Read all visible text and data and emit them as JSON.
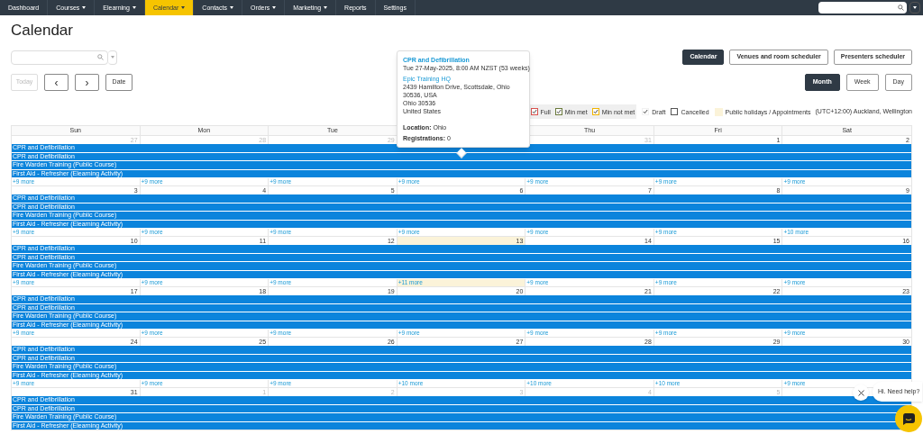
{
  "nav": {
    "items": [
      {
        "label": "Dashboard",
        "dropdown": false,
        "selected": false
      },
      {
        "label": "Courses",
        "dropdown": true,
        "selected": false
      },
      {
        "label": "Elearning",
        "dropdown": true,
        "selected": false
      },
      {
        "label": "Calendar",
        "dropdown": true,
        "selected": true
      },
      {
        "label": "Contacts",
        "dropdown": true,
        "selected": false
      },
      {
        "label": "Orders",
        "dropdown": true,
        "selected": false
      },
      {
        "label": "Marketing",
        "dropdown": true,
        "selected": false
      },
      {
        "label": "Reports",
        "dropdown": false,
        "selected": false
      },
      {
        "label": "Settings",
        "dropdown": false,
        "selected": false
      }
    ]
  },
  "page_title": "Calendar",
  "view_switch": [
    {
      "label": "Calendar",
      "selected": true
    },
    {
      "label": "Venues and room scheduler",
      "selected": false
    },
    {
      "label": "Presenters scheduler",
      "selected": false
    }
  ],
  "nav_buttons": [
    {
      "label": "Today",
      "disabled": true
    },
    {
      "label": "‹",
      "disabled": false
    },
    {
      "label": "›",
      "disabled": false
    },
    {
      "label": "Date",
      "disabled": false
    }
  ],
  "range_tabs": [
    {
      "label": "Month",
      "selected": true
    },
    {
      "label": "Week",
      "selected": false
    },
    {
      "label": "Day",
      "selected": false
    }
  ],
  "legend": [
    {
      "label": "Full",
      "kind": "checkbox",
      "checked": true,
      "color": "#d9534f"
    },
    {
      "label": "Min met",
      "kind": "checkbox",
      "checked": true,
      "color": "#6b7a3c"
    },
    {
      "label": "Min not met",
      "kind": "checkbox",
      "checked": true,
      "color": "#f0b400"
    },
    {
      "label": "Draft",
      "kind": "checkbox",
      "checked": true,
      "color": "#f1f1f1"
    },
    {
      "label": "Cancelled",
      "kind": "checkbox",
      "checked": false,
      "color": "#555555"
    },
    {
      "label": "Public holidays / Appointments",
      "kind": "swatch",
      "color": "#fbf3d9"
    }
  ],
  "timezone": "(UTC+12:00) Auckland, Wellington",
  "weekdays_left": [
    "Sun",
    "Mon",
    "Tue"
  ],
  "weekdays_right": [
    "Thu",
    "Fri",
    "Sat"
  ],
  "weeks": [
    {
      "days": [
        {
          "number": "27",
          "muted": true,
          "today": false,
          "more": "+9 more"
        },
        {
          "number": "28",
          "muted": true,
          "today": false,
          "more": "+9 more"
        },
        {
          "number": "29",
          "muted": true,
          "today": false,
          "more": "+9 more"
        },
        {
          "more": "+9 more"
        },
        {
          "number": "31",
          "muted": true,
          "today": false,
          "more": "+9 more"
        },
        {
          "number": "1",
          "muted": false,
          "today": false,
          "more": "+9 more"
        },
        {
          "number": "2",
          "muted": false,
          "today": false,
          "more": "+9 more"
        }
      ],
      "events": [
        "CPR and Defibrillation",
        "CPR and Defibrillation",
        "Fire Warden Training (Public Course)",
        "First Aid - Refresher (Elearning Activity)"
      ]
    },
    {
      "days": [
        {
          "number": "3",
          "muted": false,
          "today": false,
          "more": "+9 more"
        },
        {
          "number": "4",
          "muted": false,
          "today": false,
          "more": "+9 more"
        },
        {
          "number": "5",
          "muted": false,
          "today": false,
          "more": "+9 more"
        },
        {
          "number": "6",
          "muted": false,
          "today": false,
          "more": "+9 more"
        },
        {
          "number": "7",
          "muted": false,
          "today": false,
          "more": "+9 more"
        },
        {
          "number": "8",
          "muted": false,
          "today": false,
          "more": "+9 more"
        },
        {
          "number": "9",
          "muted": false,
          "today": false,
          "more": "+10 more"
        }
      ],
      "events": [
        "CPR and Defibrillation",
        "CPR and Defibrillation",
        "Fire Warden Training (Public Course)",
        "First Aid - Refresher (Elearning Activity)"
      ]
    },
    {
      "days": [
        {
          "number": "10",
          "muted": false,
          "today": false,
          "more": "+9 more"
        },
        {
          "number": "11",
          "muted": false,
          "today": false,
          "more": "+9 more"
        },
        {
          "number": "12",
          "muted": false,
          "today": false,
          "more": "+9 more"
        },
        {
          "number": "13",
          "muted": false,
          "today": true,
          "more": "+11 more"
        },
        {
          "number": "14",
          "muted": false,
          "today": false,
          "more": "+9 more"
        },
        {
          "number": "15",
          "muted": false,
          "today": false,
          "more": "+9 more"
        },
        {
          "number": "16",
          "muted": false,
          "today": false,
          "more": "+9 more"
        }
      ],
      "events": [
        "CPR and Defibrillation",
        "CPR and Defibrillation",
        "Fire Warden Training (Public Course)",
        "First Aid - Refresher (Elearning Activity)"
      ]
    },
    {
      "days": [
        {
          "number": "17",
          "muted": false,
          "today": false,
          "more": "+9 more"
        },
        {
          "number": "18",
          "muted": false,
          "today": false,
          "more": "+9 more"
        },
        {
          "number": "19",
          "muted": false,
          "today": false,
          "more": "+9 more"
        },
        {
          "number": "20",
          "muted": false,
          "today": false,
          "more": "+9 more"
        },
        {
          "number": "21",
          "muted": false,
          "today": false,
          "more": "+9 more"
        },
        {
          "number": "22",
          "muted": false,
          "today": false,
          "more": "+9 more"
        },
        {
          "number": "23",
          "muted": false,
          "today": false,
          "more": "+9 more"
        }
      ],
      "events": [
        "CPR and Defibrillation",
        "CPR and Defibrillation",
        "Fire Warden Training (Public Course)",
        "First Aid - Refresher (Elearning Activity)"
      ]
    },
    {
      "days": [
        {
          "number": "24",
          "muted": false,
          "today": false,
          "more": "+9 more"
        },
        {
          "number": "25",
          "muted": false,
          "today": false,
          "more": "+9 more"
        },
        {
          "number": "26",
          "muted": false,
          "today": false,
          "more": "+9 more"
        },
        {
          "number": "27",
          "muted": false,
          "today": false,
          "more": "+10 more"
        },
        {
          "number": "28",
          "muted": false,
          "today": false,
          "more": "+10 more"
        },
        {
          "number": "29",
          "muted": false,
          "today": false,
          "more": "+10 more"
        },
        {
          "number": "30",
          "muted": false,
          "today": false,
          "more": "+9 more"
        }
      ],
      "events": [
        "CPR and Defibrillation",
        "CPR and Defibrillation",
        "Fire Warden Training (Public Course)",
        "First Aid - Refresher (Elearning Activity)"
      ]
    },
    {
      "days": [
        {
          "number": "31",
          "muted": false,
          "today": false
        },
        {
          "number": "1",
          "muted": true,
          "today": false
        },
        {
          "number": "2",
          "muted": true,
          "today": false
        },
        {
          "number": "3",
          "muted": true,
          "today": false
        },
        {
          "number": "4",
          "muted": true,
          "today": false
        },
        {
          "number": "5",
          "muted": true,
          "today": false
        },
        {
          "today": false
        }
      ],
      "events": [
        "CPR and Defibrillation",
        "CPR and Defibrillation",
        "Fire Warden Training (Public Course)",
        "First Aid - Refresher (Elearning Activity)"
      ]
    }
  ],
  "popup": {
    "title": "CPR and Defibrillation",
    "when": "Tue 27-May-2025, 8:00 AM NZST (53 weeks)",
    "venue": "Epic Training HQ",
    "address": [
      "2439 Hamilton Drive, Scottsdale, Ohio",
      "30536, USA",
      "Ohio 30536",
      "United States"
    ],
    "location": "**Location:** Ohio",
    "registrations": "**Registrations:** 0"
  },
  "chat": {
    "message": "Hi. Need help?"
  }
}
